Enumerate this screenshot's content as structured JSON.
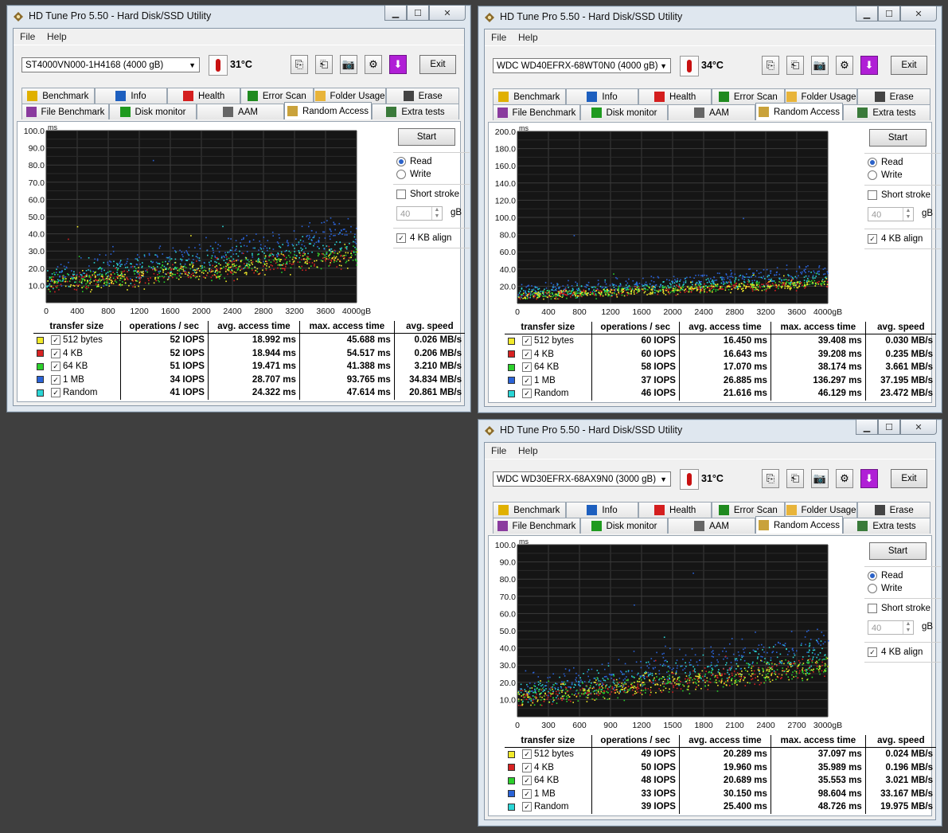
{
  "windows": [
    {
      "title": "HD Tune Pro 5.50 - Hard Disk/SSD Utility",
      "menu": [
        "File",
        "Help"
      ],
      "drive": "ST4000VN000-1H4168 (4000 gB)",
      "temperature": "31°C",
      "exit_label": "Exit",
      "tabs_row1": [
        "Benchmark",
        "Info",
        "Health",
        "Error Scan",
        "Folder Usage",
        "Erase"
      ],
      "tabs_row2": [
        "File Benchmark",
        "Disk monitor",
        "AAM",
        "Random Access",
        "Extra tests"
      ],
      "active_tab": "Random Access",
      "start_label": "Start",
      "read_label": "Read",
      "write_label": "Write",
      "short_stroke_label": "Short stroke",
      "short_stroke_value": "40",
      "gb_label": "gB",
      "align_label": "4 KB align",
      "chart_data": {
        "type": "scatter",
        "ylabel": "ms",
        "ylim": [
          0,
          100
        ],
        "yticks": [
          "100.0",
          "90.0",
          "80.0",
          "70.0",
          "60.0",
          "50.0",
          "40.0",
          "30.0",
          "20.0",
          "10.0"
        ],
        "xticks": [
          "0",
          "400",
          "800",
          "1200",
          "1600",
          "2000",
          "2400",
          "2800",
          "3200",
          "3600",
          "4000gB"
        ],
        "xlim": [
          0,
          4000
        ],
        "series": [
          {
            "name": "512 bytes",
            "color": "#f2ea2a",
            "avg_ms": 18.992,
            "max_ms": 45.688
          },
          {
            "name": "4 KB",
            "color": "#d82222",
            "avg_ms": 18.944,
            "max_ms": 54.517
          },
          {
            "name": "64 KB",
            "color": "#2bd02b",
            "avg_ms": 19.471,
            "max_ms": 41.388
          },
          {
            "name": "1 MB",
            "color": "#2a63d8",
            "avg_ms": 28.707,
            "max_ms": 93.765
          },
          {
            "name": "Random",
            "color": "#2ad6d6",
            "avg_ms": 24.322,
            "max_ms": 47.614
          }
        ]
      },
      "table": {
        "headers": [
          "transfer size",
          "operations / sec",
          "avg. access time",
          "max. access time",
          "avg. speed"
        ],
        "rows": [
          [
            "512 bytes",
            "52 IOPS",
            "18.992 ms",
            "45.688 ms",
            "0.026 MB/s"
          ],
          [
            "4 KB",
            "52 IOPS",
            "18.944 ms",
            "54.517 ms",
            "0.206 MB/s"
          ],
          [
            "64 KB",
            "51 IOPS",
            "19.471 ms",
            "41.388 ms",
            "3.210 MB/s"
          ],
          [
            "1 MB",
            "34 IOPS",
            "28.707 ms",
            "93.765 ms",
            "34.834 MB/s"
          ],
          [
            "Random",
            "41 IOPS",
            "24.322 ms",
            "47.614 ms",
            "20.861 MB/s"
          ]
        ]
      }
    },
    {
      "title": "HD Tune Pro 5.50 - Hard Disk/SSD Utility",
      "menu": [
        "File",
        "Help"
      ],
      "drive": "WDC WD40EFRX-68WT0N0 (4000 gB)",
      "temperature": "34°C",
      "exit_label": "Exit",
      "tabs_row1": [
        "Benchmark",
        "Info",
        "Health",
        "Error Scan",
        "Folder Usage",
        "Erase"
      ],
      "tabs_row2": [
        "File Benchmark",
        "Disk monitor",
        "AAM",
        "Random Access",
        "Extra tests"
      ],
      "active_tab": "Random Access",
      "start_label": "Start",
      "read_label": "Read",
      "write_label": "Write",
      "short_stroke_label": "Short stroke",
      "short_stroke_value": "40",
      "gb_label": "gB",
      "align_label": "4 KB align",
      "chart_data": {
        "type": "scatter",
        "ylabel": "ms",
        "ylim": [
          0,
          200
        ],
        "yticks": [
          "200.0",
          "180.0",
          "160.0",
          "140.0",
          "120.0",
          "100.0",
          "80.0",
          "60.0",
          "40.0",
          "20.0"
        ],
        "xticks": [
          "0",
          "400",
          "800",
          "1200",
          "1600",
          "2000",
          "2400",
          "2800",
          "3200",
          "3600",
          "4000gB"
        ],
        "xlim": [
          0,
          4000
        ],
        "series": [
          {
            "name": "512 bytes",
            "color": "#f2ea2a",
            "avg_ms": 16.45,
            "max_ms": 39.408
          },
          {
            "name": "4 KB",
            "color": "#d82222",
            "avg_ms": 16.643,
            "max_ms": 39.208
          },
          {
            "name": "64 KB",
            "color": "#2bd02b",
            "avg_ms": 17.07,
            "max_ms": 38.174
          },
          {
            "name": "1 MB",
            "color": "#2a63d8",
            "avg_ms": 26.885,
            "max_ms": 136.297
          },
          {
            "name": "Random",
            "color": "#2ad6d6",
            "avg_ms": 21.616,
            "max_ms": 46.129
          }
        ]
      },
      "table": {
        "headers": [
          "transfer size",
          "operations / sec",
          "avg. access time",
          "max. access time",
          "avg. speed"
        ],
        "rows": [
          [
            "512 bytes",
            "60 IOPS",
            "16.450 ms",
            "39.408 ms",
            "0.030 MB/s"
          ],
          [
            "4 KB",
            "60 IOPS",
            "16.643 ms",
            "39.208 ms",
            "0.235 MB/s"
          ],
          [
            "64 KB",
            "58 IOPS",
            "17.070 ms",
            "38.174 ms",
            "3.661 MB/s"
          ],
          [
            "1 MB",
            "37 IOPS",
            "26.885 ms",
            "136.297 ms",
            "37.195 MB/s"
          ],
          [
            "Random",
            "46 IOPS",
            "21.616 ms",
            "46.129 ms",
            "23.472 MB/s"
          ]
        ]
      }
    },
    {
      "title": "HD Tune Pro 5.50 - Hard Disk/SSD Utility",
      "menu": [
        "File",
        "Help"
      ],
      "drive": "WDC WD30EFRX-68AX9N0 (3000 gB)",
      "temperature": "31°C",
      "exit_label": "Exit",
      "tabs_row1": [
        "Benchmark",
        "Info",
        "Health",
        "Error Scan",
        "Folder Usage",
        "Erase"
      ],
      "tabs_row2": [
        "File Benchmark",
        "Disk monitor",
        "AAM",
        "Random Access",
        "Extra tests"
      ],
      "active_tab": "Random Access",
      "start_label": "Start",
      "read_label": "Read",
      "write_label": "Write",
      "short_stroke_label": "Short stroke",
      "short_stroke_value": "40",
      "gb_label": "gB",
      "align_label": "4 KB align",
      "chart_data": {
        "type": "scatter",
        "ylabel": "ms",
        "ylim": [
          0,
          100
        ],
        "yticks": [
          "100.0",
          "90.0",
          "80.0",
          "70.0",
          "60.0",
          "50.0",
          "40.0",
          "30.0",
          "20.0",
          "10.0"
        ],
        "xticks": [
          "0",
          "300",
          "600",
          "900",
          "1200",
          "1500",
          "1800",
          "2100",
          "2400",
          "2700",
          "3000gB"
        ],
        "xlim": [
          0,
          3000
        ],
        "series": [
          {
            "name": "512 bytes",
            "color": "#f2ea2a",
            "avg_ms": 20.289,
            "max_ms": 37.097
          },
          {
            "name": "4 KB",
            "color": "#d82222",
            "avg_ms": 19.96,
            "max_ms": 35.989
          },
          {
            "name": "64 KB",
            "color": "#2bd02b",
            "avg_ms": 20.689,
            "max_ms": 35.553
          },
          {
            "name": "1 MB",
            "color": "#2a63d8",
            "avg_ms": 30.15,
            "max_ms": 98.604
          },
          {
            "name": "Random",
            "color": "#2ad6d6",
            "avg_ms": 25.4,
            "max_ms": 48.726
          }
        ]
      },
      "table": {
        "headers": [
          "transfer size",
          "operations / sec",
          "avg. access time",
          "max. access time",
          "avg. speed"
        ],
        "rows": [
          [
            "512 bytes",
            "49 IOPS",
            "20.289 ms",
            "37.097 ms",
            "0.024 MB/s"
          ],
          [
            "4 KB",
            "50 IOPS",
            "19.960 ms",
            "35.989 ms",
            "0.196 MB/s"
          ],
          [
            "64 KB",
            "48 IOPS",
            "20.689 ms",
            "35.553 ms",
            "3.021 MB/s"
          ],
          [
            "1 MB",
            "33 IOPS",
            "30.150 ms",
            "98.604 ms",
            "33.167 MB/s"
          ],
          [
            "Random",
            "39 IOPS",
            "25.400 ms",
            "48.726 ms",
            "19.975 MB/s"
          ]
        ]
      }
    }
  ]
}
